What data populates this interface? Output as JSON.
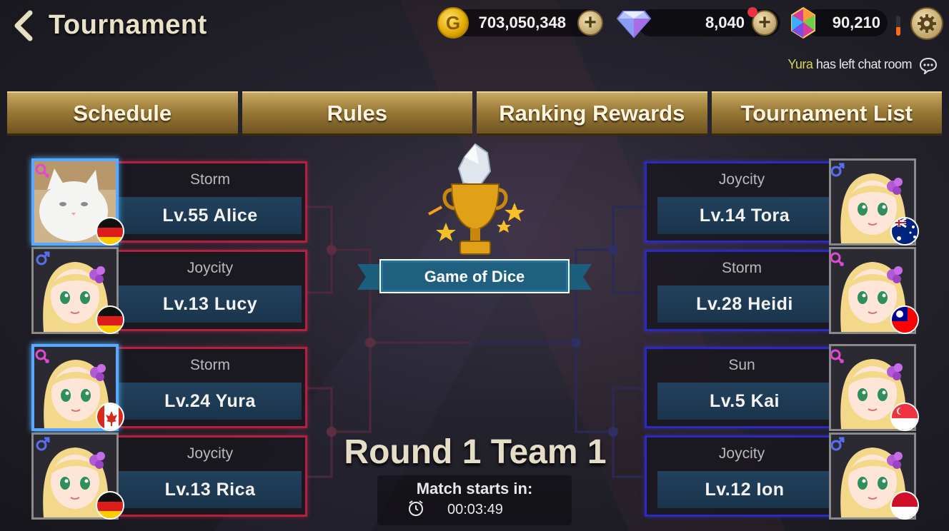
{
  "header": {
    "title": "Tournament",
    "gold": "703,050,348",
    "gems": "8,040",
    "crystals": "90,210",
    "gold_icon_letter": "G"
  },
  "chat": {
    "name": "Yura",
    "message": "has left chat room"
  },
  "tabs": [
    "Schedule",
    "Rules",
    "Ranking Rewards",
    "Tournament List"
  ],
  "left_players": [
    {
      "team": "Storm",
      "name": "Lv.55 Alice",
      "flag": "germany",
      "gender": "female",
      "avatar": "cat",
      "special": true
    },
    {
      "team": "Joycity",
      "name": "Lv.13 Lucy",
      "flag": "germany",
      "gender": "male",
      "avatar": "girl",
      "special": false
    },
    {
      "team": "Storm",
      "name": "Lv.24 Yura",
      "flag": "canada",
      "gender": "female",
      "avatar": "girl",
      "special": true
    },
    {
      "team": "Joycity",
      "name": "Lv.13 Rica",
      "flag": "germany",
      "gender": "male",
      "avatar": "girl",
      "special": false
    }
  ],
  "right_players": [
    {
      "team": "Joycity",
      "name": "Lv.14 Tora",
      "flag": "australia",
      "gender": "male",
      "avatar": "girl"
    },
    {
      "team": "Storm",
      "name": "Lv.28 Heidi",
      "flag": "taiwan",
      "gender": "female",
      "avatar": "girl"
    },
    {
      "team": "Sun",
      "name": "Lv.5 Kai",
      "flag": "singapore",
      "gender": "female",
      "avatar": "girl"
    },
    {
      "team": "Joycity",
      "name": "Lv.12 Ion",
      "flag": "indonesia",
      "gender": "male",
      "avatar": "girl"
    }
  ],
  "event": {
    "name": "Game of Dice"
  },
  "round": {
    "title": "Round 1 Team 1",
    "match_label": "Match starts in:",
    "timer": "00:03:49"
  },
  "colors": {
    "left_frame": "#b4203f",
    "right_frame": "#2c29c0",
    "tab_gold": "#9a7a38",
    "banner": "#1f6e8c"
  }
}
